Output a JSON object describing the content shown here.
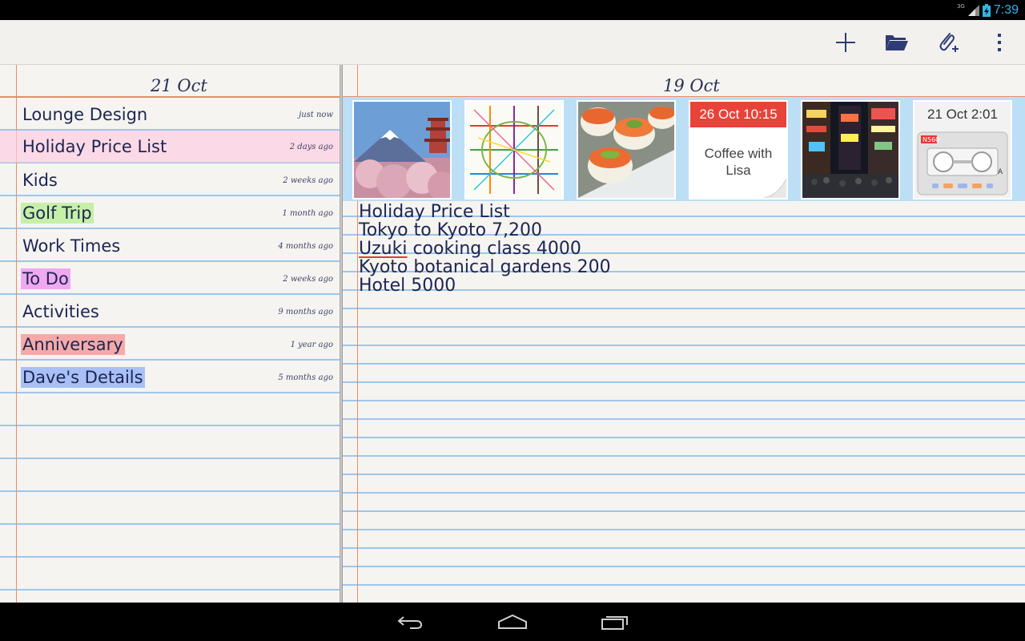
{
  "status_bar": {
    "time": "7:39",
    "network": "3G"
  },
  "action_bar": {
    "icons": [
      "plus-icon",
      "folder-icon",
      "attach-icon",
      "overflow-menu-icon"
    ]
  },
  "left_pane": {
    "date": "21 Oct",
    "notes": [
      {
        "title": "Lounge Design",
        "time": "just now",
        "highlight": ""
      },
      {
        "title": "Holiday Price List",
        "time": "2 days ago",
        "highlight": "row-pink"
      },
      {
        "title": "Kids",
        "time": "2 weeks ago",
        "highlight": ""
      },
      {
        "title": "Golf Trip",
        "time": "1 month ago",
        "highlight": "#c6f0a8"
      },
      {
        "title": "Work Times",
        "time": "4 months ago",
        "highlight": ""
      },
      {
        "title": "To Do",
        "time": "2 weeks ago",
        "highlight": "#f0a8f0"
      },
      {
        "title": "Activities",
        "time": "9 months ago",
        "highlight": ""
      },
      {
        "title": "Anniversary",
        "time": "1 year ago",
        "highlight": "#f5aaa8"
      },
      {
        "title": "Dave's Details",
        "time": "5 months ago",
        "highlight": "#a8c0f5"
      }
    ]
  },
  "right_pane": {
    "date": "19 Oct",
    "attachments": [
      {
        "type": "image",
        "name": "mount-fuji-photo-thumbnail"
      },
      {
        "type": "image",
        "name": "subway-map-thumbnail"
      },
      {
        "type": "image",
        "name": "sushi-photo-thumbnail"
      },
      {
        "type": "memo",
        "header": "26 Oct 10:15",
        "body_line1": "Coffee with",
        "body_line2": "Lisa",
        "header_color": "#e8433a"
      },
      {
        "type": "image",
        "name": "city-night-photo-thumbnail"
      },
      {
        "type": "audio",
        "header": "21 Oct 2:01",
        "tape_label": "N560",
        "side": "A"
      }
    ],
    "note_lines": [
      "Holiday Price List",
      "Tokyo to Kyoto 7,200",
      "cooking class 4000",
      "Kyoto botanical gardens 200",
      "Hotel 5000"
    ],
    "misspelled_word": "Uzuki"
  },
  "colors": {
    "paper": "#f5f4f1",
    "rule": "#9ec6ec",
    "margin": "#e58e6a",
    "ink": "#1d2552",
    "accent": "#33b5e5"
  }
}
